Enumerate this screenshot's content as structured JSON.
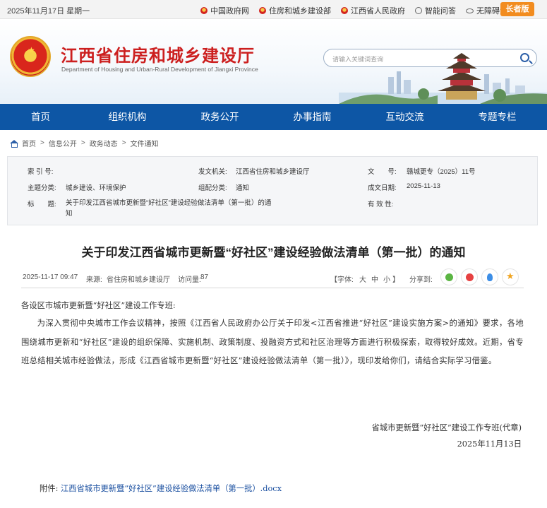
{
  "topbar": {
    "date": "2025年11月17日 星期一",
    "links": [
      {
        "label": "中国政府网",
        "icon": "emblem-icon"
      },
      {
        "label": "住房和城乡建设部",
        "icon": "emblem-icon"
      },
      {
        "label": "江西省人民政府",
        "icon": "emblem-icon"
      },
      {
        "label": "智能问答",
        "icon": "headset-icon"
      },
      {
        "label": "无障碍浏览",
        "icon": "eye-icon"
      }
    ],
    "elder_mode": "长者版"
  },
  "header": {
    "title": "江西省住房和城乡建设厅",
    "subtitle": "Department of Housing and Urban-Rural Development of Jiangxi Province",
    "search_placeholder": "请输入关键词查询"
  },
  "nav": [
    "首页",
    "组织机构",
    "政务公开",
    "办事指南",
    "互动交流",
    "专题专栏"
  ],
  "breadcrumb": [
    "首页",
    "信息公开",
    "政务动态",
    "文件通知"
  ],
  "meta": {
    "index_label": "索 引 号:",
    "index_value": "",
    "issuer_label": "发文机关:",
    "issuer_value": "江西省住房和城乡建设厅",
    "docno_label": "文　　号:",
    "docno_value": "赣城更专（2025）11号",
    "topic_label": "主题分类:",
    "topic_value": "城乡建设、环境保护",
    "category_label": "组配分类:",
    "category_value": "通知",
    "date_label": "成文日期:",
    "date_value": "2025-11-13",
    "title_label": "标　　题:",
    "title_value": "关于印发江西省城市更新暨“好社区”建设经验做法清单（第一批）的通知",
    "validity_label": "有 效 性:",
    "validity_value": ""
  },
  "article": {
    "title": "关于印发江西省城市更新暨“好社区”建设经验做法清单（第一批）的通知",
    "published": "2025-11-17 09:47",
    "source_label": "来源:",
    "source": "省住房和城乡建设厅",
    "views_label": "访问量:",
    "views": "87",
    "font_label": "【字体:",
    "font_large": "大",
    "font_medium": "中",
    "font_small": "小",
    "font_close": "】",
    "share_label": "分享到:",
    "salutation": "各设区市城市更新暨“好社区”建设工作专班:",
    "paragraph": "为深入贯彻中央城市工作会议精神，按照《江西省人民政府办公厅关于印发<江西省推进“好社区”建设实施方案>的通知》要求，各地围绕城市更新和“好社区”建设的组织保障、实施机制、政策制度、投融资方式和社区治理等方面进行积极探索，取得较好成效。近期，省专班总结相关城市经验做法，形成《江西省城市更新暨“好社区”建设经验做法清单（第一批）》，现印发给你们，请结合实际学习借鉴。",
    "signature": "省城市更新暨“好社区”建设工作专班(代章)",
    "sign_date": "2025年11月13日",
    "attachment_label": "附件:",
    "attachment": "江西省城市更新暨“好社区”建设经验做法清单（第一批）.docx"
  },
  "colors": {
    "nav": "#0d56a5",
    "title_red": "#cc1f1f",
    "elder_button": "#f28c1f",
    "link": "#1a4fa0"
  }
}
